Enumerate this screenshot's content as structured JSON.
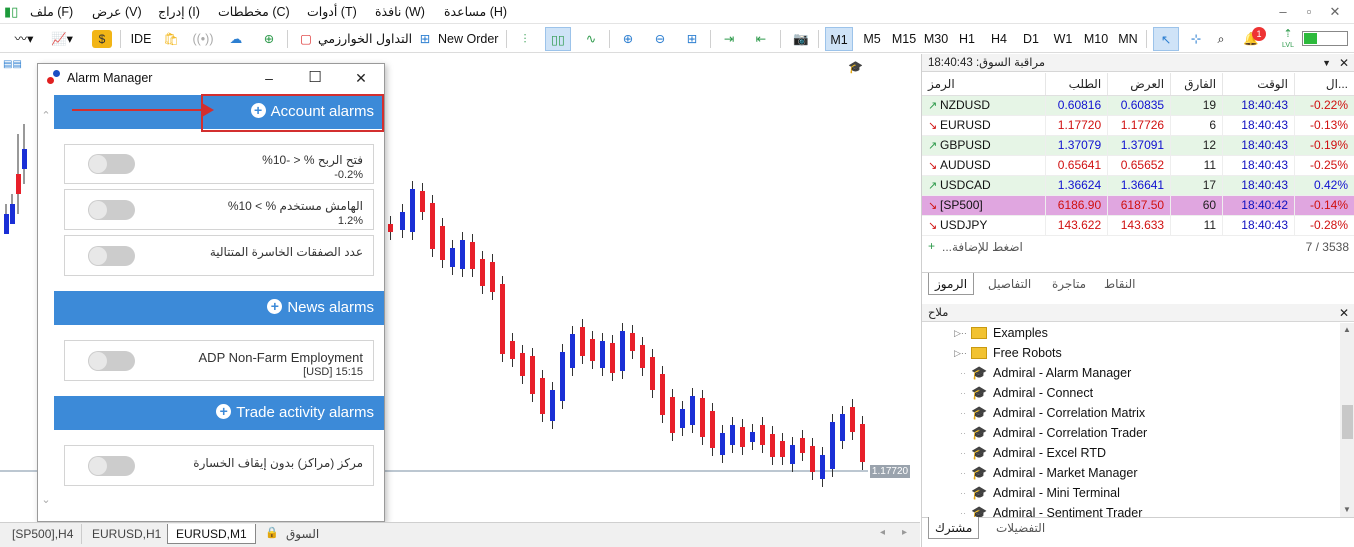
{
  "menubar": {
    "items": [
      "ملف (F)",
      "عرض (V)",
      "إدراج (I)",
      "مخططات (C)",
      "أدوات (T)",
      "نافذة (W)",
      "مساعدة (H)"
    ]
  },
  "toolbar": {
    "ide": "IDE",
    "algo": "التداول الخوارزمي",
    "new_order": "New Order",
    "timeframes": [
      "M1",
      "M5",
      "M15",
      "M30",
      "H1",
      "H4",
      "D1",
      "W1",
      "M10",
      "MN"
    ],
    "active_tf": "M1",
    "notif_count": "1",
    "lvl": "LVL"
  },
  "chart": {
    "price_tag": "1.17720"
  },
  "alarm": {
    "title": "Alarm Manager",
    "sections": {
      "account": "Account alarms",
      "news": "News alarms",
      "trade": "Trade activity alarms"
    },
    "cards": [
      {
        "l1": "فتح الربح % < -10%",
        "l2": "-0.2%"
      },
      {
        "l1": "الهامش مستخدم % > 10%",
        "l2": "1.2%"
      },
      {
        "l1": "عدد الصفقات الخاسرة المتتالية",
        "l2": ""
      },
      {
        "l1": "ADP Non-Farm Employment",
        "l2": "[USD] 15:15"
      },
      {
        "l1": "مركز (مراكز) بدون إيقاف الخسارة",
        "l2": ""
      }
    ]
  },
  "market_watch": {
    "title": "مراقبة السوق: 18:40:43",
    "headers": [
      "الرمز",
      "الطلب",
      "العرض",
      "الفارق",
      "الوقت",
      "ال..."
    ],
    "rows": [
      {
        "sym": "NZDUSD",
        "dir": "up",
        "bid": "0.60816",
        "ask": "0.60835",
        "spread": "19",
        "time": "18:40:43",
        "chg": "-0.22%"
      },
      {
        "sym": "EURUSD",
        "dir": "down",
        "bid": "1.17720",
        "ask": "1.17726",
        "spread": "6",
        "time": "18:40:43",
        "chg": "-0.13%"
      },
      {
        "sym": "GBPUSD",
        "dir": "up",
        "bid": "1.37079",
        "ask": "1.37091",
        "spread": "12",
        "time": "18:40:43",
        "chg": "-0.19%"
      },
      {
        "sym": "AUDUSD",
        "dir": "down",
        "bid": "0.65641",
        "ask": "0.65652",
        "spread": "11",
        "time": "18:40:43",
        "chg": "-0.25%"
      },
      {
        "sym": "USDCAD",
        "dir": "up",
        "bid": "1.36624",
        "ask": "1.36641",
        "spread": "17",
        "time": "18:40:43",
        "chg": "0.42%"
      },
      {
        "sym": "[SP500]",
        "dir": "down",
        "bid": "6186.90",
        "ask": "6187.50",
        "spread": "60",
        "time": "18:40:42",
        "chg": "-0.14%"
      },
      {
        "sym": "USDJPY",
        "dir": "down",
        "bid": "143.622",
        "ask": "143.633",
        "spread": "11",
        "time": "18:40:43",
        "chg": "-0.28%"
      }
    ],
    "add_label": "اضغط للإضافة...",
    "count": "7 / 3538",
    "tabs": [
      "الرموز",
      "التفاصيل",
      "متاجرة",
      "النقاط"
    ]
  },
  "navigator": {
    "title": "ملاح",
    "items": [
      {
        "label": "Examples",
        "type": "folder"
      },
      {
        "label": "Free Robots",
        "type": "folder"
      },
      {
        "label": "Admiral - Alarm Manager",
        "type": "ea"
      },
      {
        "label": "Admiral - Connect",
        "type": "ea"
      },
      {
        "label": "Admiral - Correlation Matrix",
        "type": "ea"
      },
      {
        "label": "Admiral - Correlation Trader",
        "type": "ea"
      },
      {
        "label": "Admiral - Excel RTD",
        "type": "ea"
      },
      {
        "label": "Admiral - Market Manager",
        "type": "ea"
      },
      {
        "label": "Admiral - Mini Terminal",
        "type": "ea"
      },
      {
        "label": "Admiral - Sentiment Trader",
        "type": "ea"
      }
    ],
    "tabs": [
      "مشترك",
      "التفضيلات"
    ]
  },
  "bottom_tabs": [
    "[SP500],H4",
    "EURUSD,H1",
    "EURUSD,M1",
    "السوق"
  ],
  "colors": {
    "section_blue": "#3c8ad8",
    "bear": "#e8202a",
    "bull": "#1a2fd6",
    "highlight_row": "#e0a6e0",
    "red_annotation": "#d32f2f"
  }
}
